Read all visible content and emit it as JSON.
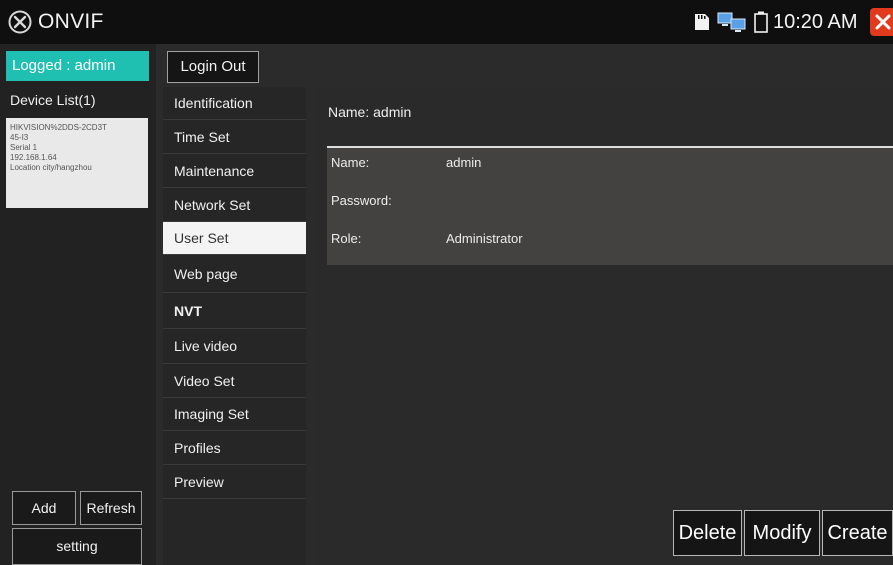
{
  "app": {
    "title": "ONVIF",
    "time": "10:20 AM"
  },
  "colors": {
    "accent": "#1fbfb2",
    "close": "#e23a1c"
  },
  "icons": [
    "onvif-logo-icon",
    "sd-card-icon",
    "network-icon",
    "battery-icon",
    "close-icon"
  ],
  "session": {
    "logged": "Logged : admin",
    "login_out": "Login Out"
  },
  "devices": {
    "title": "Device List(1)",
    "items": [
      {
        "model": "HIKVISION%2DDS-2CD3T",
        "model2": "45-I3",
        "serial": "Serial 1",
        "ip": "192.168.1.64",
        "location": "Location city/hangzhou"
      }
    ]
  },
  "left_buttons": {
    "add": "Add",
    "refresh": "Refresh",
    "setting": "setting"
  },
  "menu": {
    "items": [
      "Identification",
      "Time Set",
      "Maintenance",
      "Network Set",
      "User Set",
      "Web page",
      "NVT",
      "Live video",
      "Video Set",
      "Imaging Set",
      "Profiles",
      "Preview"
    ],
    "active": "User Set"
  },
  "user": {
    "header": "Name: admin",
    "name_label": "Name:",
    "name_value": "admin",
    "password_label": "Password:",
    "password_value": "",
    "role_label": "Role:",
    "role_value": "Administrator"
  },
  "actions": {
    "delete": "Delete",
    "modify": "Modify",
    "create": "Create"
  }
}
